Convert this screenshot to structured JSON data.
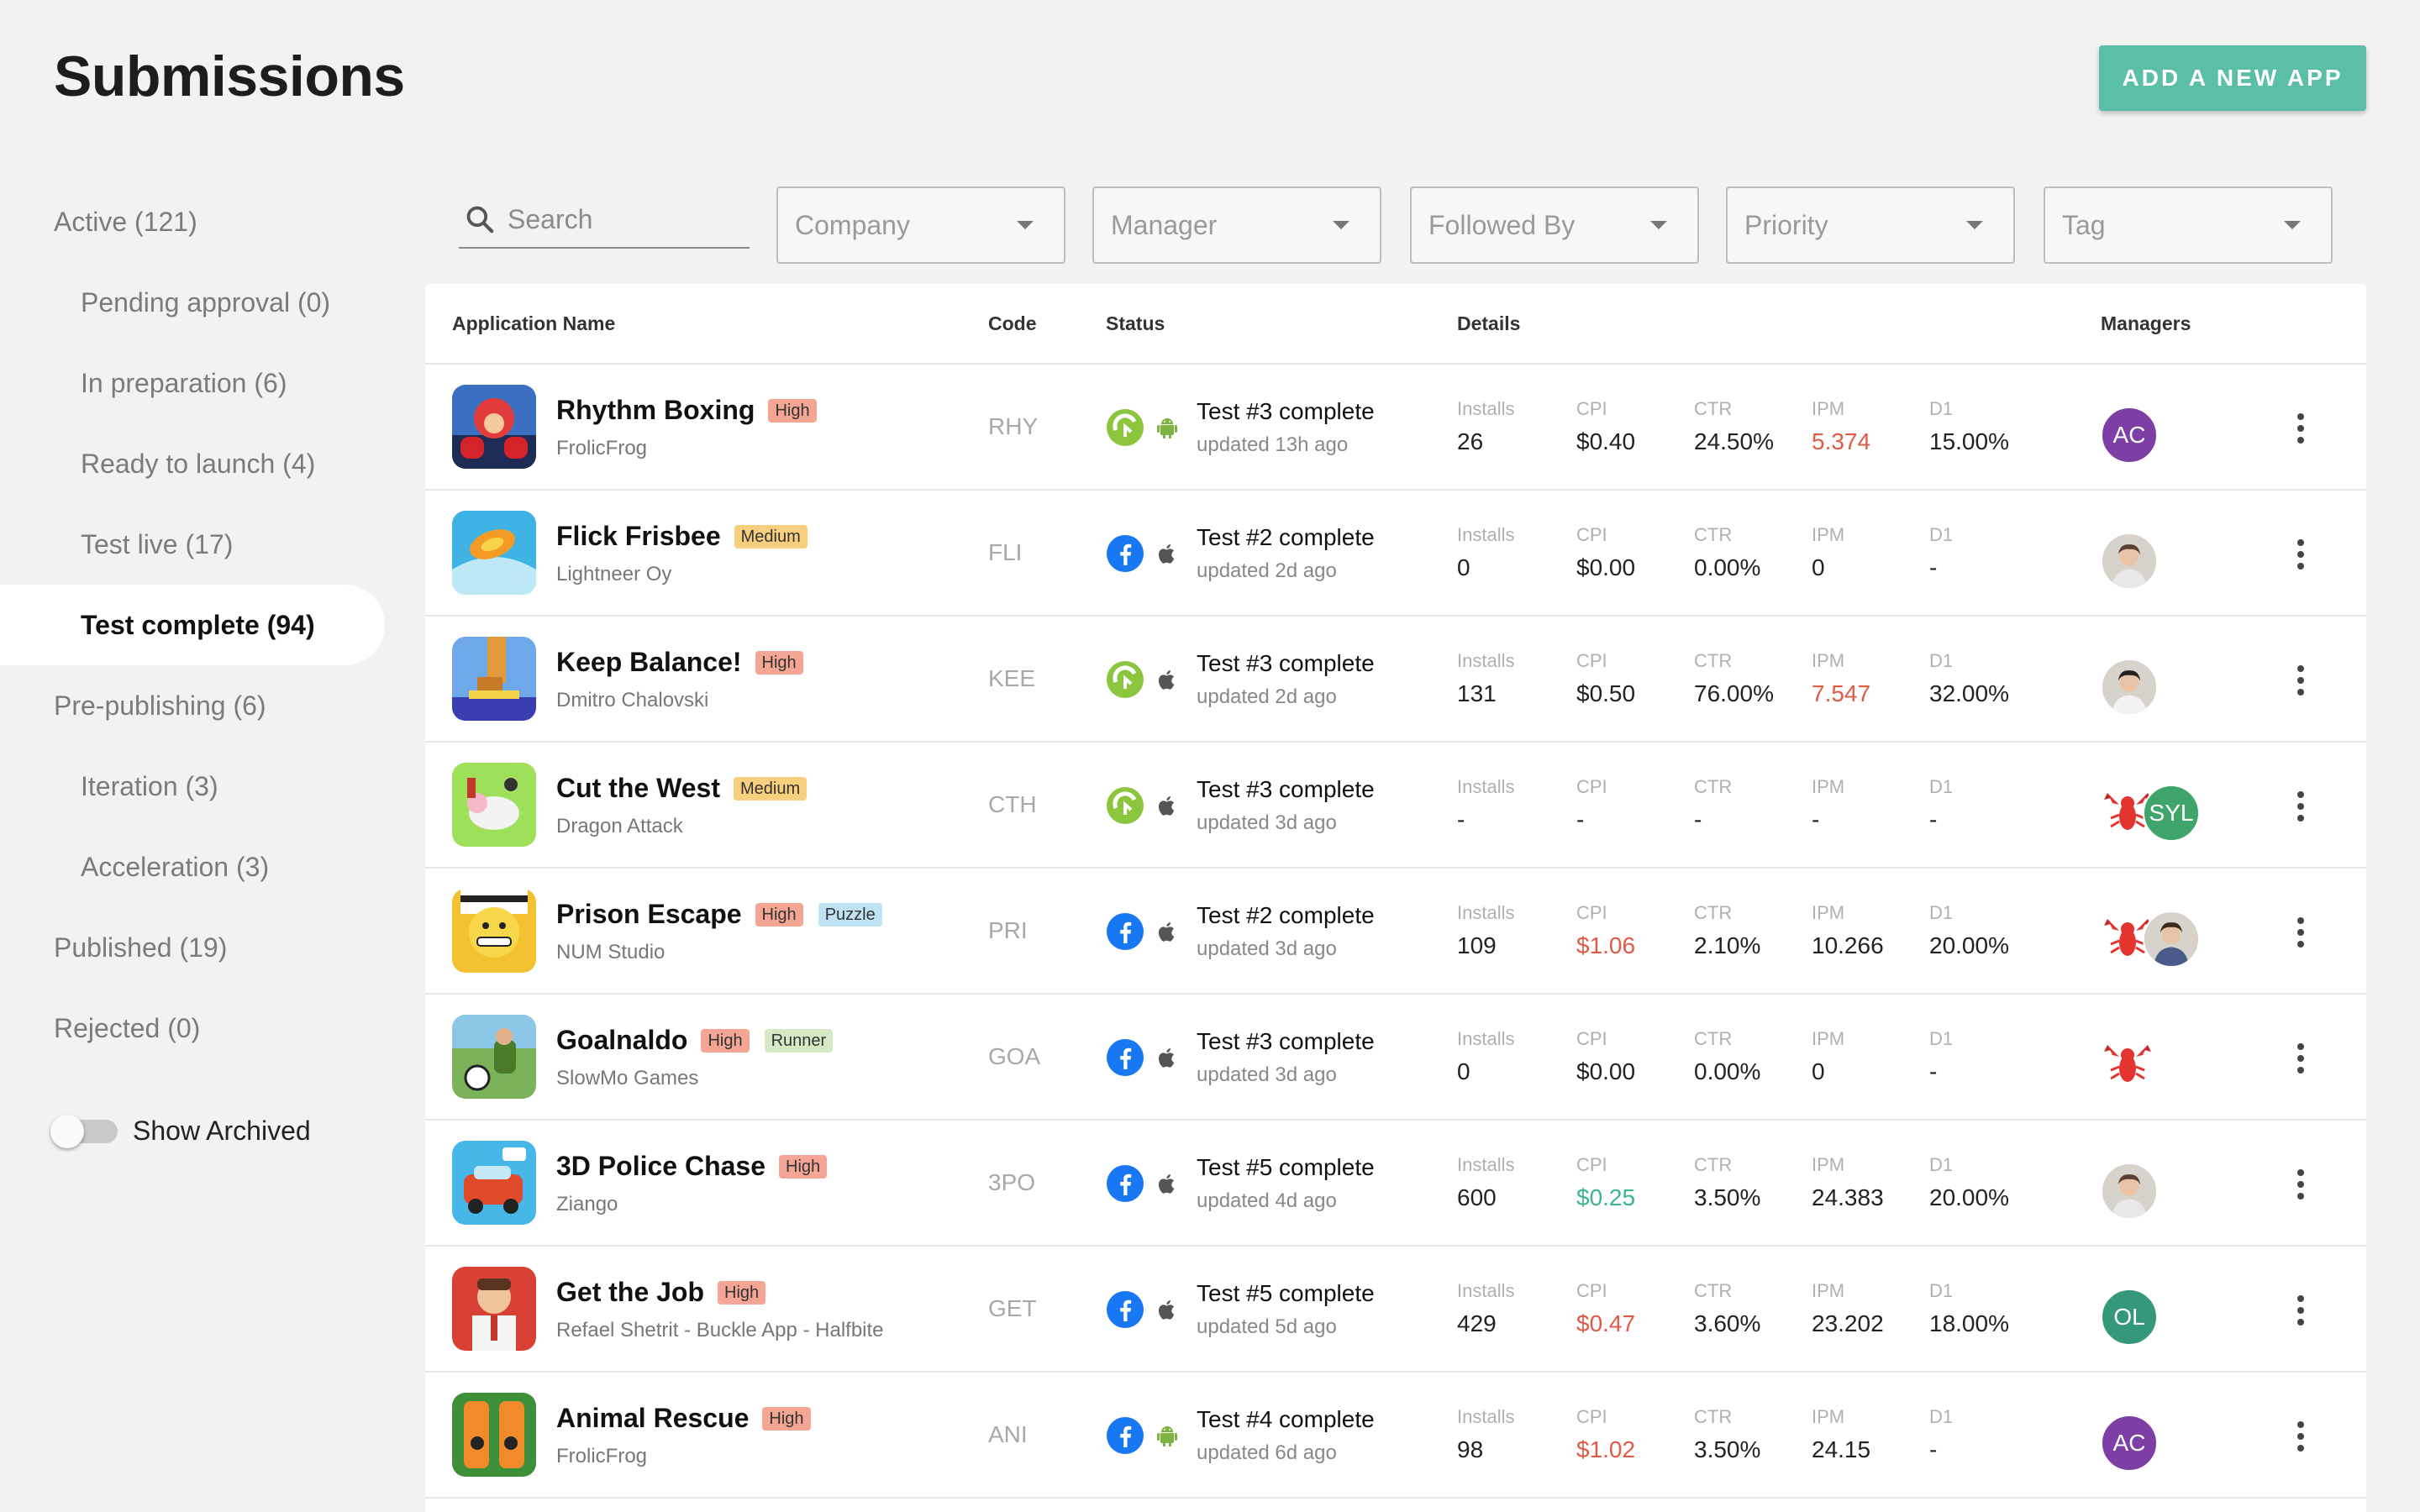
{
  "header": {
    "title": "Submissions",
    "add_button": "ADD A NEW APP"
  },
  "sidebar": {
    "items": [
      {
        "label": "Active (121)",
        "level": 0
      },
      {
        "label": "Pending approval (0)",
        "level": 1
      },
      {
        "label": "In preparation (6)",
        "level": 1
      },
      {
        "label": "Ready to launch (4)",
        "level": 1
      },
      {
        "label": "Test live (17)",
        "level": 1
      },
      {
        "label": "Test complete (94)",
        "level": 1,
        "selected": true
      },
      {
        "label": "Pre-publishing (6)",
        "level": 0
      },
      {
        "label": "Iteration (3)",
        "level": 1
      },
      {
        "label": "Acceleration (3)",
        "level": 1
      },
      {
        "label": "Published (19)",
        "level": 0
      },
      {
        "label": "Rejected (0)",
        "level": 0
      }
    ],
    "show_archived": {
      "label": "Show Archived",
      "on": false
    }
  },
  "filters": {
    "search_placeholder": "Search",
    "selects": [
      "Company",
      "Manager",
      "Followed By",
      "Priority",
      "Tag"
    ]
  },
  "table": {
    "columns": {
      "app_name": "Application Name",
      "code": "Code",
      "status": "Status",
      "details": "Details",
      "managers": "Managers"
    },
    "metric_labels": [
      "Installs",
      "CPI",
      "CTR",
      "IPM",
      "D1"
    ],
    "rows": [
      {
        "name": "Rhythm Boxing",
        "priority": "High",
        "category": "",
        "company": "FrolicFrog",
        "code": "RHY",
        "channel": "lime-icon",
        "platform": "android-icon",
        "status": "Test #3 complete",
        "updated": "updated 13h ago",
        "installs": "26",
        "cpi": "$0.40",
        "ctr": "24.50%",
        "ipm": "5.374",
        "d1": "15.00%",
        "cpi_color": "",
        "ipm_color": "red",
        "managers": [
          "AC"
        ]
      },
      {
        "name": "Flick Frisbee",
        "priority": "Medium",
        "category": "",
        "company": "Lightneer Oy",
        "code": "FLI",
        "channel": "facebook-icon",
        "platform": "apple-icon",
        "status": "Test #2 complete",
        "updated": "updated 2d ago",
        "installs": "0",
        "cpi": "$0.00",
        "ctr": "0.00%",
        "ipm": "0",
        "d1": "-",
        "cpi_color": "",
        "ipm_color": "",
        "managers": [
          "photo-male"
        ]
      },
      {
        "name": "Keep Balance!",
        "priority": "High",
        "category": "",
        "company": "Dmitro Chalovski",
        "code": "KEE",
        "channel": "lime-icon",
        "platform": "apple-icon",
        "status": "Test #3 complete",
        "updated": "updated 2d ago",
        "installs": "131",
        "cpi": "$0.50",
        "ctr": "76.00%",
        "ipm": "7.547",
        "d1": "32.00%",
        "cpi_color": "",
        "ipm_color": "red",
        "managers": [
          "photo-female"
        ]
      },
      {
        "name": "Cut the West",
        "priority": "Medium",
        "category": "",
        "company": "Dragon Attack",
        "code": "CTH",
        "channel": "lime-icon",
        "platform": "apple-icon",
        "status": "Test #3 complete",
        "updated": "updated 3d ago",
        "installs": "-",
        "cpi": "-",
        "ctr": "-",
        "ipm": "-",
        "d1": "-",
        "cpi_color": "",
        "ipm_color": "",
        "managers": [
          "lobster",
          "SYL"
        ]
      },
      {
        "name": "Prison Escape",
        "priority": "High",
        "category": "Puzzle",
        "company": "NUM Studio",
        "code": "PRI",
        "channel": "facebook-icon",
        "platform": "apple-icon",
        "status": "Test #2 complete",
        "updated": "updated 3d ago",
        "installs": "109",
        "cpi": "$1.06",
        "ctr": "2.10%",
        "ipm": "10.266",
        "d1": "20.00%",
        "cpi_color": "red",
        "ipm_color": "",
        "managers": [
          "lobster",
          "photo-male2"
        ]
      },
      {
        "name": "Goalnaldo",
        "priority": "High",
        "category": "Runner",
        "company": "SlowMo Games",
        "code": "GOA",
        "channel": "facebook-icon",
        "platform": "apple-icon",
        "status": "Test #3 complete",
        "updated": "updated 3d ago",
        "installs": "0",
        "cpi": "$0.00",
        "ctr": "0.00%",
        "ipm": "0",
        "d1": "-",
        "cpi_color": "",
        "ipm_color": "",
        "managers": [
          "lobster"
        ]
      },
      {
        "name": "3D Police Chase",
        "priority": "High",
        "category": "",
        "company": "Ziango",
        "code": "3PO",
        "channel": "facebook-icon",
        "platform": "apple-icon",
        "status": "Test #5 complete",
        "updated": "updated 4d ago",
        "installs": "600",
        "cpi": "$0.25",
        "ctr": "3.50%",
        "ipm": "24.383",
        "d1": "20.00%",
        "cpi_color": "green",
        "ipm_color": "",
        "managers": [
          "photo-male"
        ]
      },
      {
        "name": "Get the Job",
        "priority": "High",
        "category": "",
        "company": "Refael Shetrit - Buckle App - Halfbite",
        "code": "GET",
        "channel": "facebook-icon",
        "platform": "apple-icon",
        "status": "Test #5 complete",
        "updated": "updated 5d ago",
        "installs": "429",
        "cpi": "$0.47",
        "ctr": "3.60%",
        "ipm": "23.202",
        "d1": "18.00%",
        "cpi_color": "red",
        "ipm_color": "",
        "managers": [
          "OL"
        ]
      },
      {
        "name": "Animal Rescue",
        "priority": "High",
        "category": "",
        "company": "FrolicFrog",
        "code": "ANI",
        "channel": "facebook-icon",
        "platform": "android-icon",
        "status": "Test #4 complete",
        "updated": "updated 6d ago",
        "installs": "98",
        "cpi": "$1.02",
        "ctr": "3.50%",
        "ipm": "24.15",
        "d1": "-",
        "cpi_color": "red",
        "ipm_color": "",
        "managers": [
          "AC"
        ]
      }
    ]
  },
  "colors": {
    "accent": "#5bbfa8",
    "high_tag": "#f4a593",
    "medium_tag": "#f8cf7e",
    "bad_value": "#e05a45",
    "good_value": "#3cb58a"
  }
}
